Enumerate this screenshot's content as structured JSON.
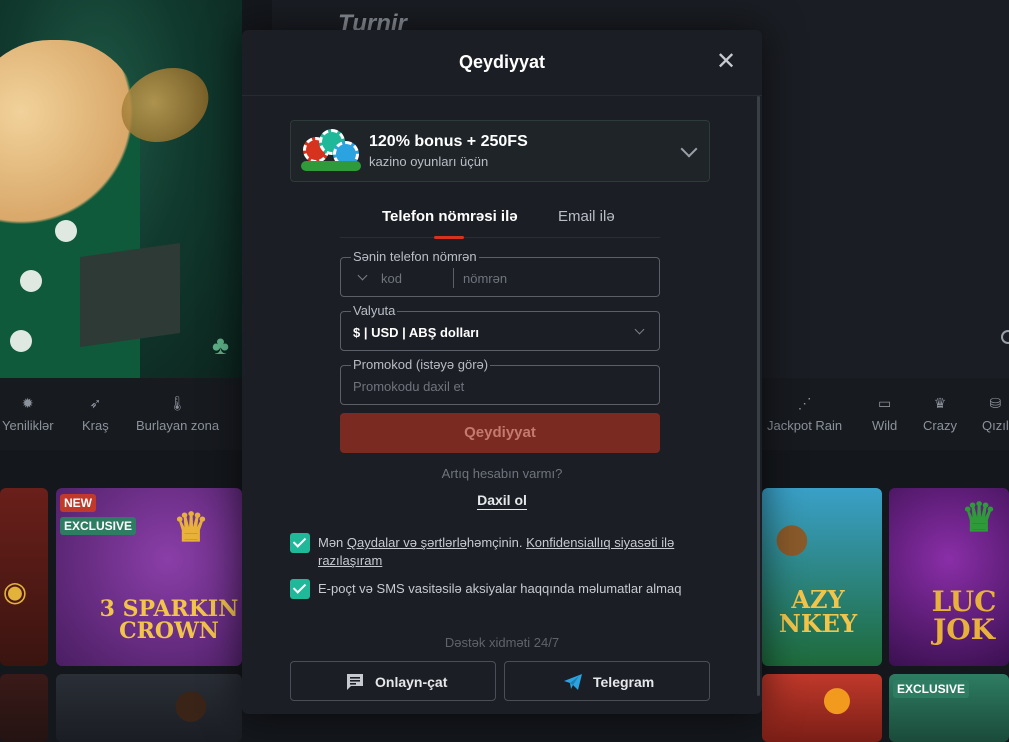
{
  "background": {
    "hero_title": "Turnir",
    "categories": [
      {
        "label": "Yeniliklər",
        "icon": "new-badge-icon"
      },
      {
        "label": "Kraş",
        "icon": "rocket-icon"
      },
      {
        "label": "Burlayan zona",
        "icon": "thermometer-icon"
      },
      {
        "label": "Jackpot Rain",
        "icon": "rain-icon"
      },
      {
        "label": "Wild",
        "icon": "wild-icon"
      },
      {
        "label": "Crazy",
        "icon": "jester-icon"
      },
      {
        "label": "Qızıl",
        "icon": "gold-icon"
      }
    ],
    "badges": {
      "new": "NEW",
      "exclusive": "EXCLUSIVE"
    },
    "games": {
      "sparkling_crown": "3 SPARKIN CROWN",
      "crazy_monkey": "AZY NKEY",
      "lucky_joker": "LUC JOK"
    }
  },
  "modal": {
    "title": "Qeydiyyat",
    "close_icon": "close-icon",
    "bonus": {
      "title": "120% bonus + 250FS",
      "subtitle": "kazino oyunları üçün",
      "icon": "casino-chips-icon"
    },
    "tabs": [
      {
        "label": "Telefon nömrəsi ilə",
        "active": true
      },
      {
        "label": "Email ilə",
        "active": false
      }
    ],
    "phone": {
      "label": "Sənin telefon nömrən",
      "code_placeholder": "kod",
      "number_placeholder": "nömrən"
    },
    "currency": {
      "label": "Valyuta",
      "value": "$ | USD | ABŞ dolları"
    },
    "promo": {
      "label": "Promokod (istəyə görə)",
      "placeholder": "Promokodu daxil et"
    },
    "submit_label": "Qeydiyyat",
    "have_account": "Artıq hesabın varmı?",
    "login_label": "Daxil ol",
    "consent": {
      "prefix": "Mən ",
      "rules_link": "Qaydalar və şərtlərlə",
      "middle": "həmçinin. ",
      "privacy_link": "Konfidensiallıq siyasəti ilə razılaşıram",
      "checked": true
    },
    "marketing": {
      "text": "E-poçt və SMS vasitəsilə aksiyalar haqqında məlumatlar almaq",
      "checked": true
    },
    "support_title": "Dəstək xidməti 24/7",
    "support_buttons": [
      {
        "label": "Onlayn-çat",
        "icon": "chat-icon"
      },
      {
        "label": "Telegram",
        "icon": "telegram-icon"
      }
    ]
  },
  "colors": {
    "accent_red": "#d6331f",
    "submit_disabled": "#7a2a20",
    "checkbox": "#1fb99a",
    "telegram_blue": "#2aa3e0"
  }
}
